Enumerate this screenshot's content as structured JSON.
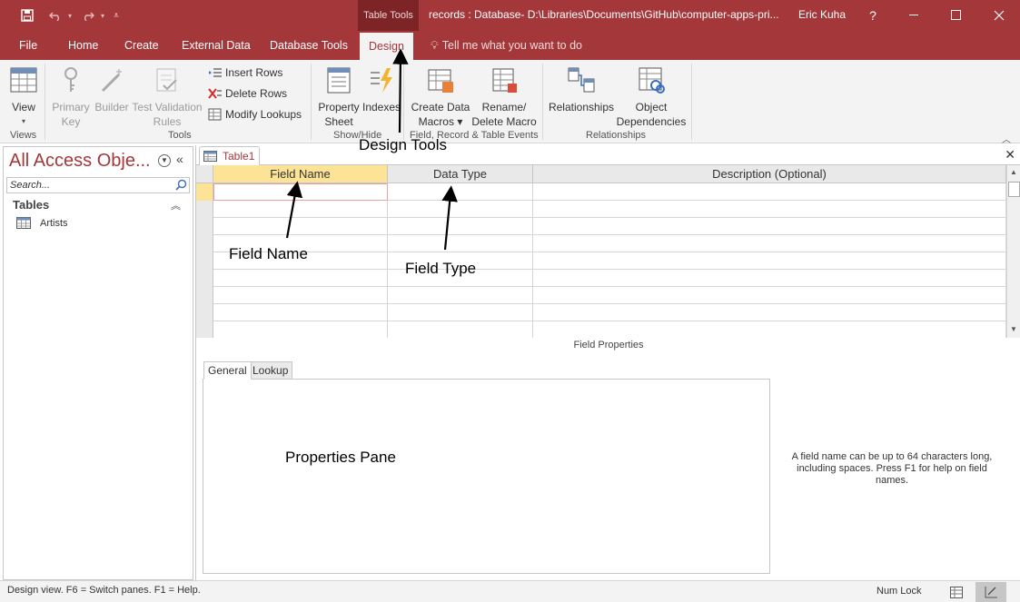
{
  "titlebar": {
    "contextual_group": "Table Tools",
    "window_title": "records : Database- D:\\Libraries\\Documents\\GitHub\\computer-apps-pri...",
    "user_name": "Eric Kuha",
    "help": "?",
    "colors": {
      "brand": "#a4373a",
      "contextual": "#7c2426"
    }
  },
  "ribbon_tabs": {
    "file": "File",
    "home": "Home",
    "create": "Create",
    "external_data": "External Data",
    "database_tools": "Database Tools",
    "design": "Design",
    "tell_me": "Tell me what you want to do"
  },
  "ribbon": {
    "views": {
      "view_top": "View",
      "view_bottom": "▾",
      "group": "Views"
    },
    "tools": {
      "primary_key_1": "Primary",
      "primary_key_2": "Key",
      "builder": "Builder",
      "test_validation_1": "Test Validation",
      "test_validation_2": "Rules",
      "insert_rows": "Insert Rows",
      "delete_rows": "Delete Rows",
      "modify_lookups": "Modify Lookups",
      "group": "Tools"
    },
    "show_hide": {
      "property_sheet_1": "Property",
      "property_sheet_2": "Sheet",
      "indexes": "Indexes",
      "group": "Show/Hide"
    },
    "events": {
      "create_data_macros_1": "Create Data",
      "create_data_macros_2": "Macros ▾",
      "rename_delete_macro_1": "Rename/",
      "rename_delete_macro_2": "Delete Macro",
      "group": "Field, Record & Table Events"
    },
    "relationships": {
      "relationships": "Relationships",
      "object_dependencies_1": "Object",
      "object_dependencies_2": "Dependencies",
      "group": "Relationships"
    }
  },
  "navpane": {
    "title": "All Access Obje...",
    "search_placeholder": "Search...",
    "group_header": "Tables",
    "items": [
      {
        "label": "Artists"
      }
    ]
  },
  "document": {
    "tab_label": "Table1",
    "columns": [
      "Field Name",
      "Data Type",
      "Description (Optional)"
    ],
    "field_properties_label": "Field Properties",
    "property_tabs": [
      "General",
      "Lookup"
    ],
    "help_text": "A field name can be up to 64 characters long, including spaces. Press F1 for help on field names."
  },
  "annotations": {
    "design_tools": "Design Tools",
    "field_name": "Field Name",
    "field_type": "Field Type",
    "properties_pane": "Properties Pane"
  },
  "statusbar": {
    "text": "Design view.  F6 = Switch panes.  F1 = Help.",
    "num_lock": "Num Lock"
  }
}
